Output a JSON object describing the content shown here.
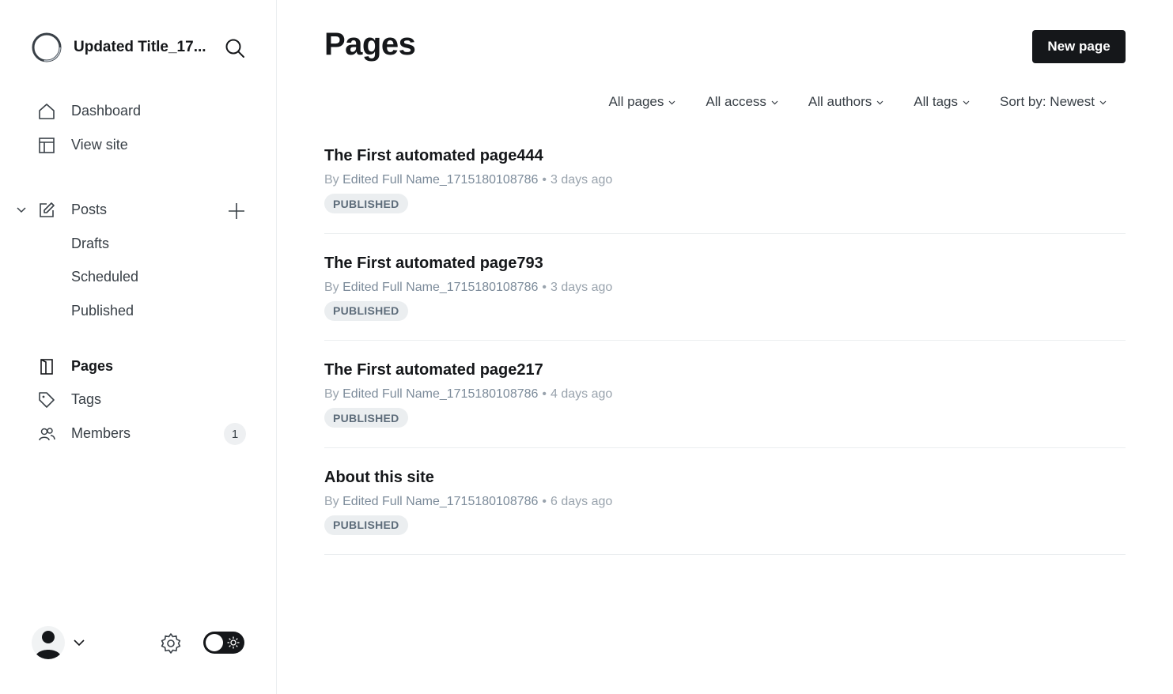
{
  "sidebar": {
    "site_title": "Updated Title_17...",
    "nav": {
      "dashboard": "Dashboard",
      "view_site": "View site",
      "posts": "Posts",
      "drafts": "Drafts",
      "scheduled": "Scheduled",
      "published": "Published",
      "pages": "Pages",
      "tags": "Tags",
      "members": "Members",
      "members_count": "1"
    }
  },
  "main": {
    "title": "Pages",
    "new_page_label": "New page",
    "filters": {
      "type": "All pages",
      "access": "All access",
      "authors": "All authors",
      "tags": "All tags",
      "sort": "Sort by: Newest"
    },
    "pages": [
      {
        "title": "The First automated page444",
        "by": "By",
        "author": "Edited Full Name_1715180108786",
        "time": "3 days ago",
        "status": "PUBLISHED"
      },
      {
        "title": "The First automated page793",
        "by": "By",
        "author": "Edited Full Name_1715180108786",
        "time": "3 days ago",
        "status": "PUBLISHED"
      },
      {
        "title": "The First automated page217",
        "by": "By",
        "author": "Edited Full Name_1715180108786",
        "time": "4 days ago",
        "status": "PUBLISHED"
      },
      {
        "title": "About this site",
        "by": "By",
        "author": "Edited Full Name_1715180108786",
        "time": "6 days ago",
        "status": "PUBLISHED"
      }
    ]
  },
  "colors": {
    "primary": "#15171a",
    "text_muted": "#99a3ad",
    "badge_bg": "#ebeef0",
    "divider": "#ebeef0"
  },
  "icons": [
    "site-logo",
    "search-icon",
    "home-icon",
    "layout-icon",
    "chevron-down-icon",
    "edit-icon",
    "plus-icon",
    "page-icon",
    "tag-icon",
    "members-icon",
    "user-icon",
    "gear-icon",
    "sun-icon"
  ]
}
